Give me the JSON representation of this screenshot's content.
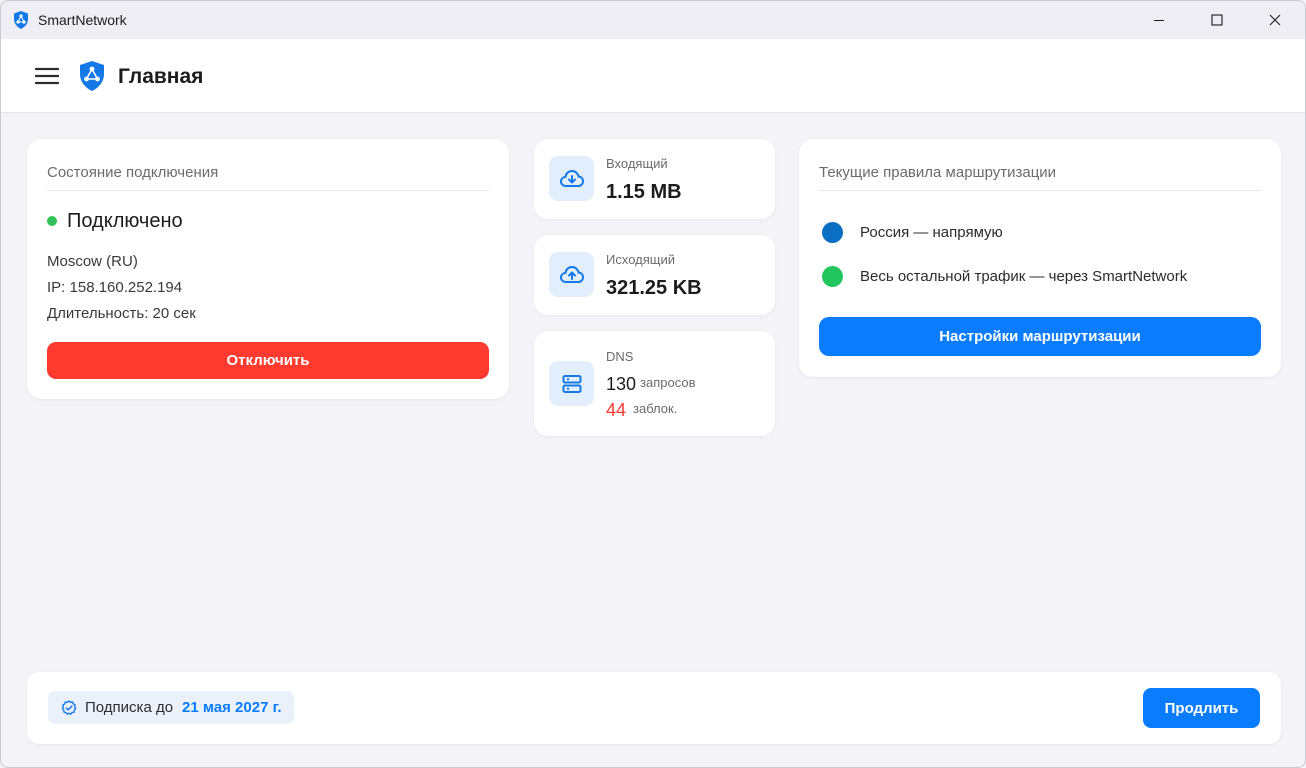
{
  "window": {
    "title": "SmartNetwork"
  },
  "header": {
    "title": "Главная"
  },
  "connection": {
    "title": "Состояние подключения",
    "status": "Подключено",
    "location": "Moscow (RU)",
    "ip": "IP: 158.160.252.194",
    "duration": "Длительность: 20 сек",
    "disconnect_label": "Отключить"
  },
  "stats": {
    "incoming": {
      "label": "Входящий",
      "value": "1.15 MB"
    },
    "outgoing": {
      "label": "Исходящий",
      "value": "321.25 KB"
    },
    "dns": {
      "label": "DNS",
      "requests_count": "130",
      "requests_label": "запросов",
      "blocked_count": "44",
      "blocked_label": "заблок."
    }
  },
  "routing": {
    "title": "Текущие правила маршрутизации",
    "rules": [
      {
        "text": "Россия — напрямую",
        "color": "#0a6fc2"
      },
      {
        "text": "Весь остальной трафик — через SmartNetwork",
        "color": "#22c55e"
      }
    ],
    "settings_label": "Настройки маршрутизации"
  },
  "footer": {
    "subscription_label": "Подписка до",
    "subscription_date": "21 мая 2027 г.",
    "extend_label": "Продлить"
  },
  "colors": {
    "accent": "#0a7cff",
    "danger": "#ff3b30",
    "connected": "#30c158"
  }
}
